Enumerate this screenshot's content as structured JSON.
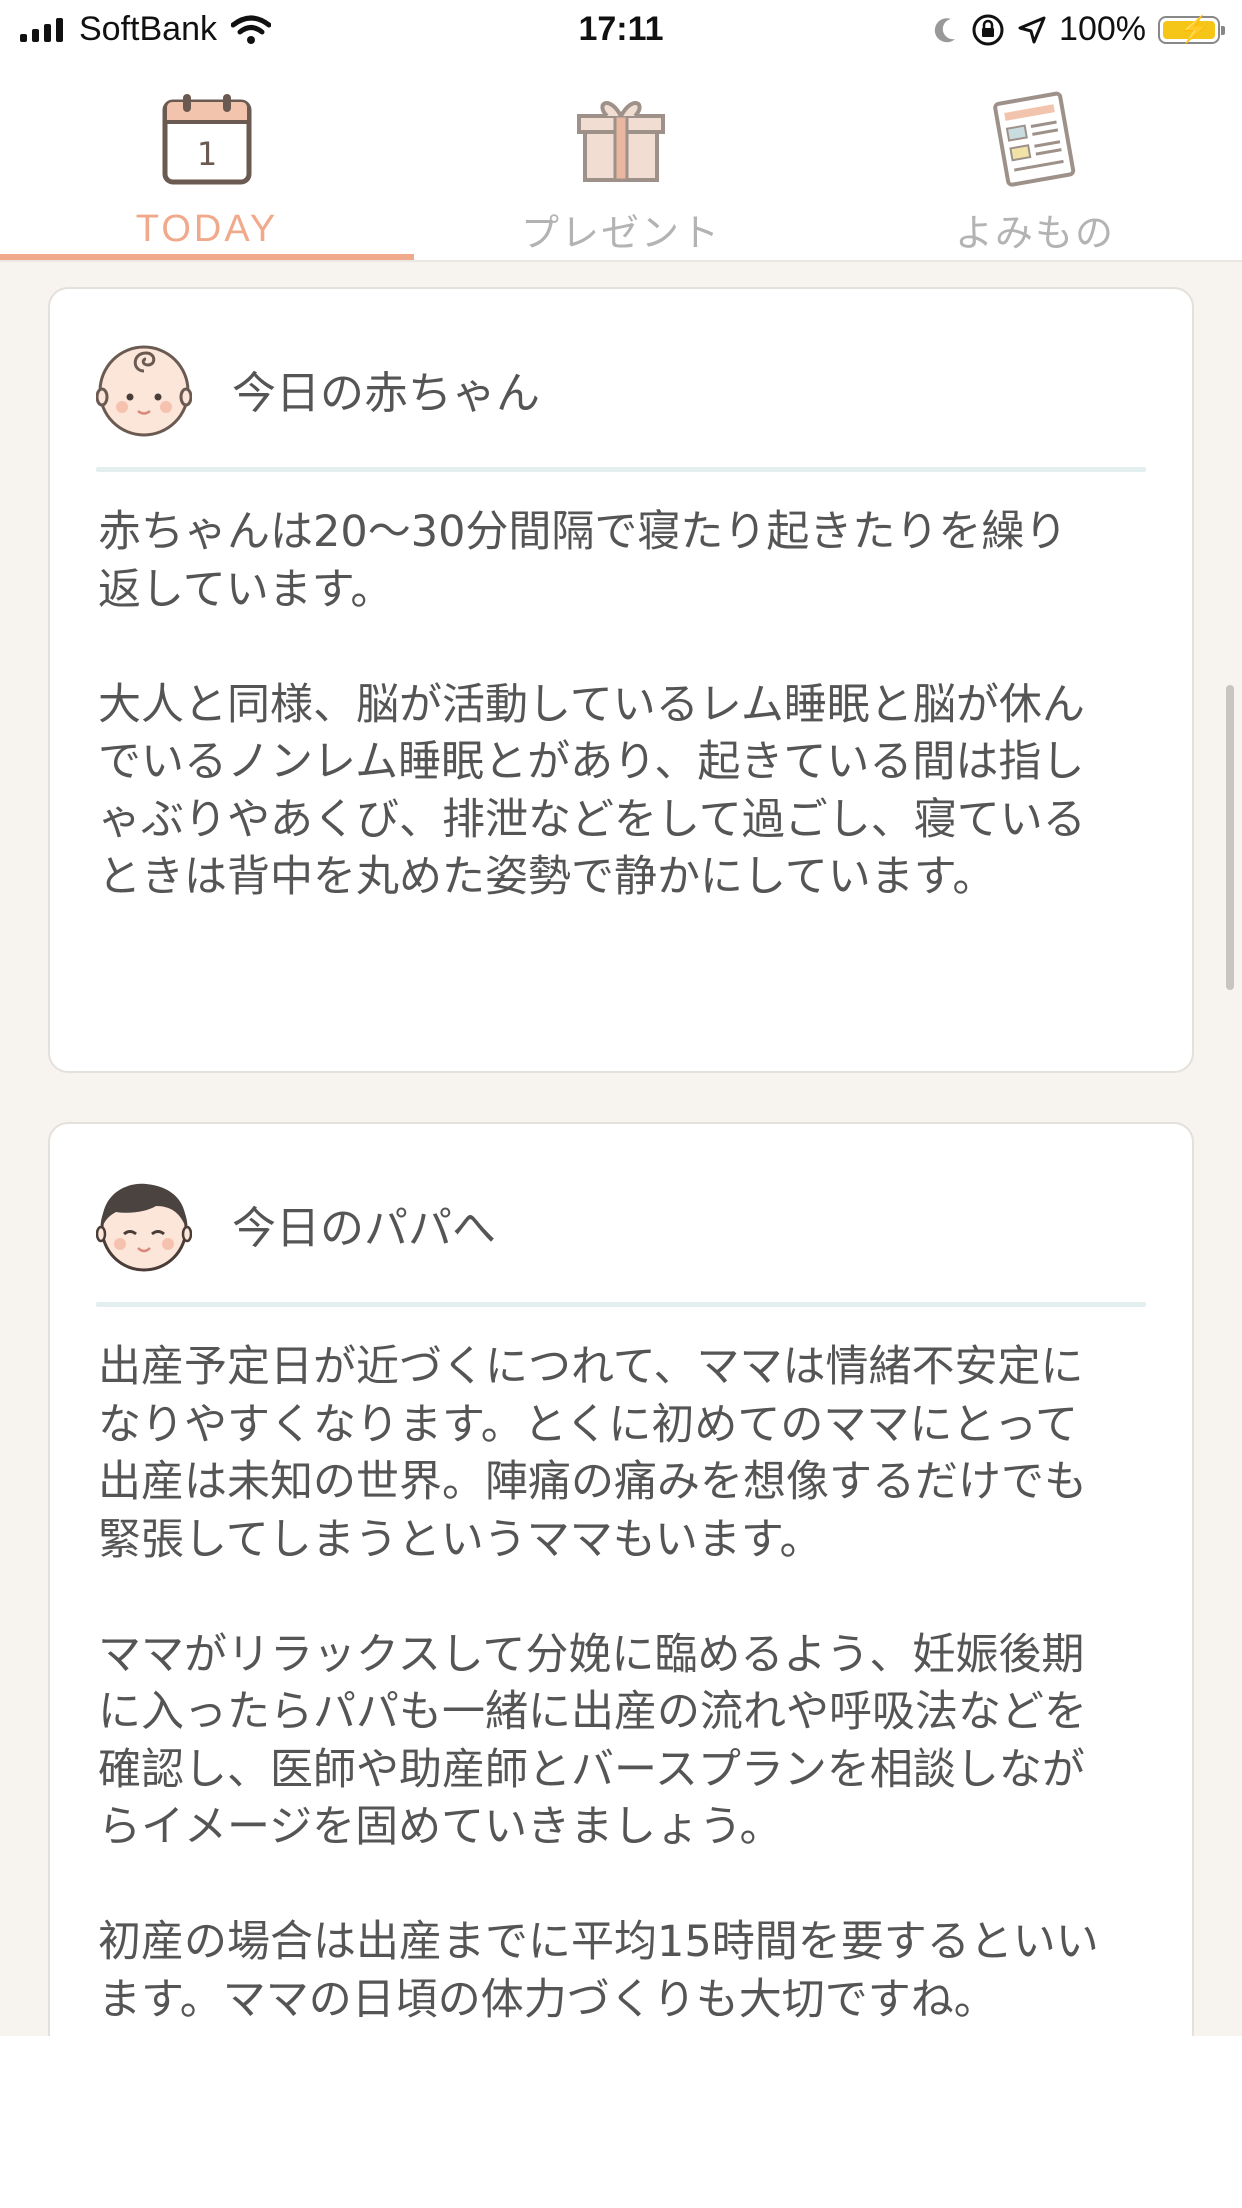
{
  "status_bar": {
    "carrier": "SoftBank",
    "time": "17:11",
    "battery_percent": "100%",
    "icons": [
      "signal-icon",
      "wifi-icon",
      "moon-icon",
      "orientation-lock-icon",
      "location-icon",
      "battery-icon"
    ]
  },
  "tabs": [
    {
      "label": "TODAY",
      "icon": "calendar-icon",
      "calendar_day": "1",
      "selected": true
    },
    {
      "label": "プレゼント",
      "icon": "gift-icon",
      "selected": false
    },
    {
      "label": "よみもの",
      "icon": "newspaper-icon",
      "selected": false
    }
  ],
  "colors": {
    "accent": "#f0a98a",
    "background": "#f7f3ef",
    "card": "#ffffff",
    "rule": "#e3eeee",
    "inactive_tab": "#b3b3b3"
  },
  "cards": [
    {
      "icon": "baby-face-icon",
      "title": "今日の赤ちゃん",
      "body": "赤ちゃんは20〜30分間隔で寝たり起きたりを繰り\n返しています。\n\n大人と同様、脳が活動しているレム睡眠と脳が休ん\nでいるノンレム睡眠とがあり、起きている間は指し\nゃぶりやあくび、排泄などをして過ごし、寝ている\nときは背中を丸めた姿勢で静かにしています。"
    },
    {
      "icon": "papa-face-icon",
      "title": "今日のパパへ",
      "body": "出産予定日が近づくにつれて、ママは情緒不安定に\nなりやすくなります。とくに初めてのママにとって\n出産は未知の世界。陣痛の痛みを想像するだけでも\n緊張してしまうというママもいます。\n\nママがリラックスして分娩に臨めるよう、妊娠後期\nに入ったらパパも一緒に出産の流れや呼吸法などを\n確認し、医師や助産師とバースプランを相談しなが\nらイメージを固めていきましょう。\n\n初産の場合は出産までに平均15時間を要するといい\nます。ママの日頃の体力づくりも大切ですね。"
    }
  ]
}
